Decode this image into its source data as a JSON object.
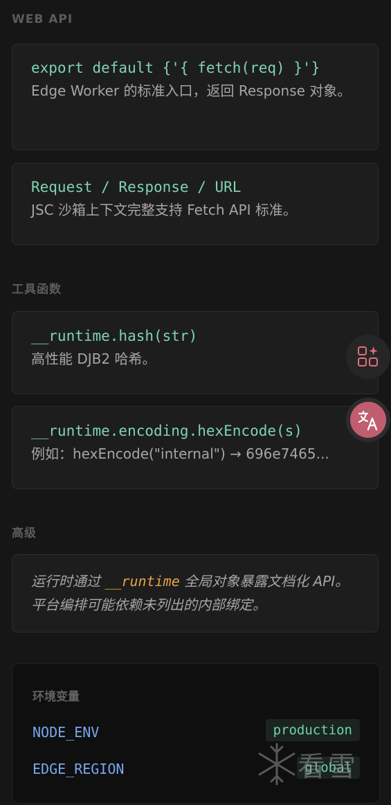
{
  "sections": {
    "web_api": "WEB API",
    "tools": "工具函数",
    "advanced": "高级"
  },
  "cards": {
    "fetch": {
      "code": "export default {'{ fetch(req) }'}",
      "desc": "Edge Worker 的标准入口，返回 Response 对象。"
    },
    "request": {
      "code": "Request / Response / URL",
      "desc": "JSC 沙箱上下文完整支持 Fetch API 标准。"
    },
    "hash": {
      "code": "__runtime.hash(str)",
      "desc": "高性能 DJB2 哈希。"
    },
    "hex": {
      "code": "__runtime.encoding.hexEncode(s)",
      "desc": "例如：hexEncode(\"internal\") → 696e7465..."
    },
    "advanced": {
      "pre": "运行时通过 ",
      "highlight": "__runtime",
      "post": " 全局对象暴露文档化 API。平台编排可能依赖未列出的内部绑定。"
    }
  },
  "env": {
    "title": "环境变量",
    "rows": [
      {
        "key": "NODE_ENV",
        "value": "production"
      },
      {
        "key": "EDGE_REGION",
        "value": "global"
      }
    ]
  },
  "floating": {
    "apps_icon": "apps-sparkle-icon",
    "translate_icon": "translate-icon"
  },
  "watermark": {
    "text": "看雪"
  },
  "colors": {
    "background": "#161616",
    "code": "#7fd4b0",
    "highlight": "#e8a14b",
    "env_key": "#7aa7f0",
    "translate_accent": "#c05e70"
  }
}
